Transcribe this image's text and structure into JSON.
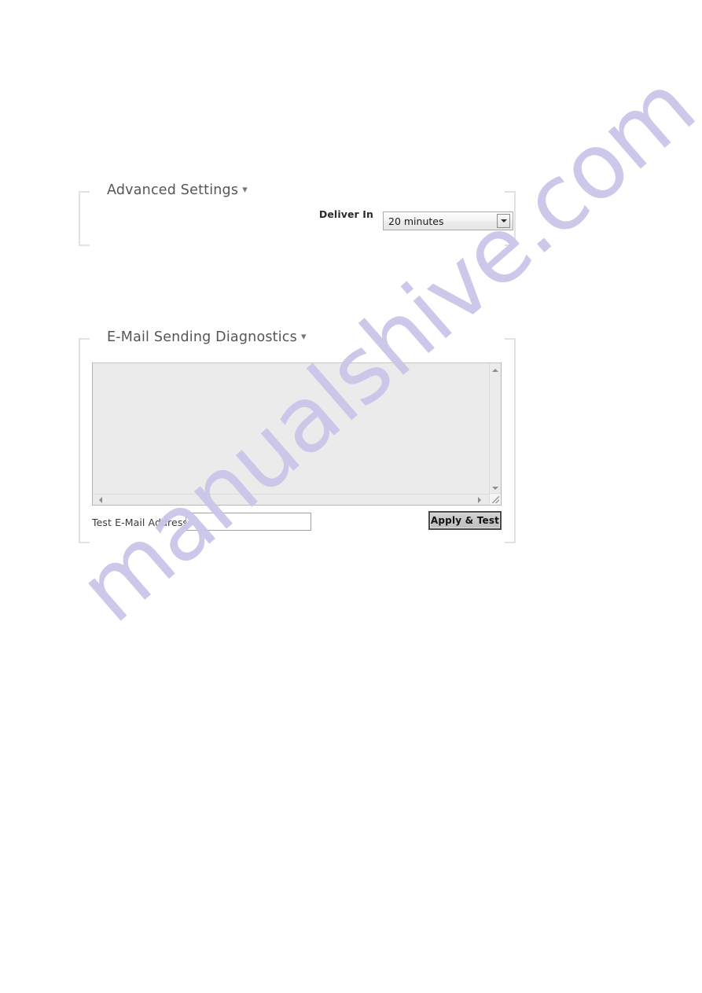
{
  "page": {
    "background_color": "#ffffff",
    "watermark": {
      "text": "manualshive.com",
      "color": "#c9c6e9"
    }
  },
  "advanced_settings": {
    "title": "Advanced Settings",
    "collapse_chevron": "chevron-down-icon",
    "fields": {
      "deliver_in": {
        "label": "Deliver In",
        "value": "20 minutes",
        "dropdown_icon": "triangle-down-icon"
      }
    }
  },
  "diagnostics": {
    "title": "E-Mail Sending Diagnostics",
    "collapse_chevron": "chevron-down-icon",
    "log": {
      "value": "",
      "placeholder": ""
    },
    "scrollbars": {
      "up_icon": "triangle-up-icon",
      "down_icon": "triangle-down-icon",
      "left_icon": "triangle-left-icon",
      "right_icon": "triangle-right-icon",
      "resize_grip_icon": "resize-grip-icon"
    },
    "test_email": {
      "label": "Test E-Mail Address",
      "value": "",
      "placeholder": ""
    },
    "apply_test_button": {
      "label": "Apply & Test"
    }
  }
}
